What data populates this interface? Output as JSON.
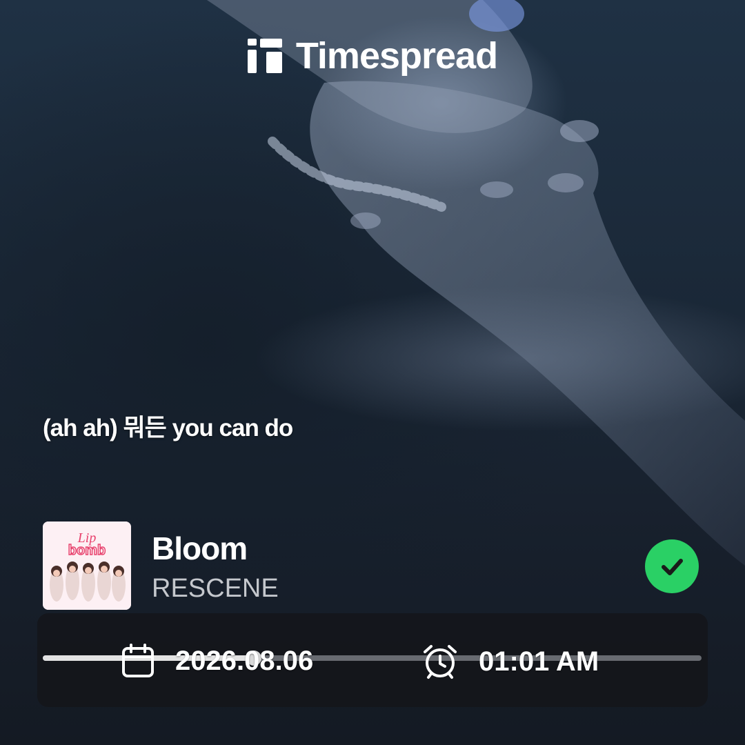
{
  "brand": {
    "name": "Timespread",
    "logo_icon": "timespread-logo-icon"
  },
  "lyric": {
    "text": "(ah ah) 뭐든 you can do"
  },
  "track": {
    "title": "Bloom",
    "artist": "RESCENE",
    "album_art_text": "Lip bomb",
    "status_icon": "check-circle-icon"
  },
  "meta": {
    "date": "2026.08.06",
    "time": "01:01 AM",
    "date_icon": "calendar-icon",
    "time_icon": "alarm-clock-icon"
  },
  "playback": {
    "progress": 0.32
  },
  "colors": {
    "accent_green": "#2ad065",
    "album_pink": "#e8436e",
    "text_primary": "#ffffff",
    "text_secondary": "#c5c8cd"
  }
}
